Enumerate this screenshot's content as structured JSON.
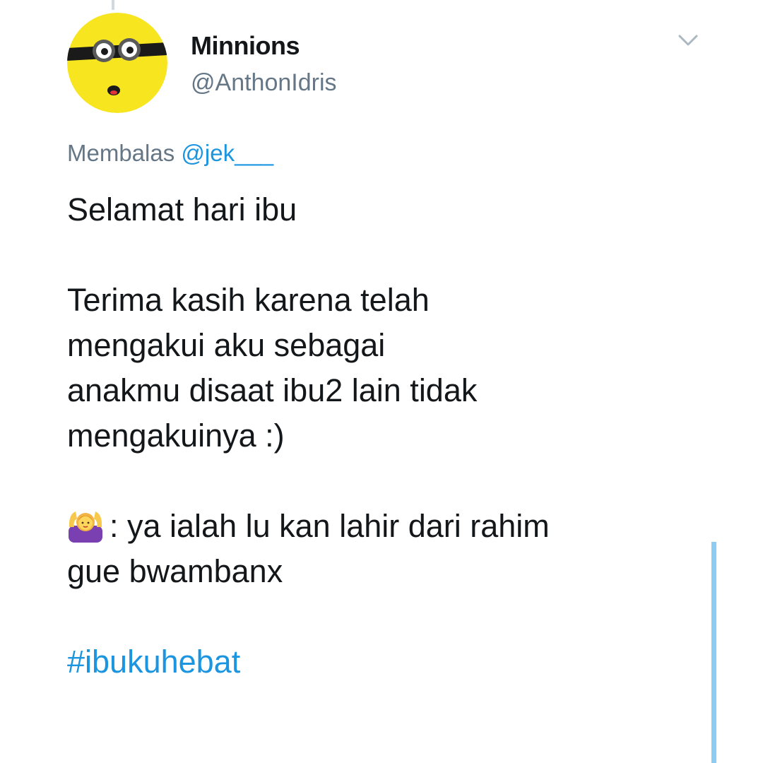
{
  "tweet": {
    "display_name": "Minnions",
    "handle": "@AnthonIdris",
    "reply_prefix": "Membalas",
    "reply_mention": "@jek___",
    "lines": {
      "l1": "Selamat hari ibu",
      "l2": "Terima kasih karena telah",
      "l3": "mengakui aku sebagai",
      "l4": "anakmu disaat ibu2 lain tidak",
      "l5": "mengakuinya :)",
      "l6": ": ya ialah lu kan lahir dari rahim",
      "l7": "gue bwambanx"
    },
    "hashtag": "#ibukuhebat",
    "emoji_name": "woman-gesturing-ok-emoji"
  },
  "colors": {
    "text": "#14171a",
    "secondary": "#657786",
    "link": "#1b95e0",
    "thread_line": "#8dcdf3",
    "avatar_yellow": "#f7e51f"
  }
}
